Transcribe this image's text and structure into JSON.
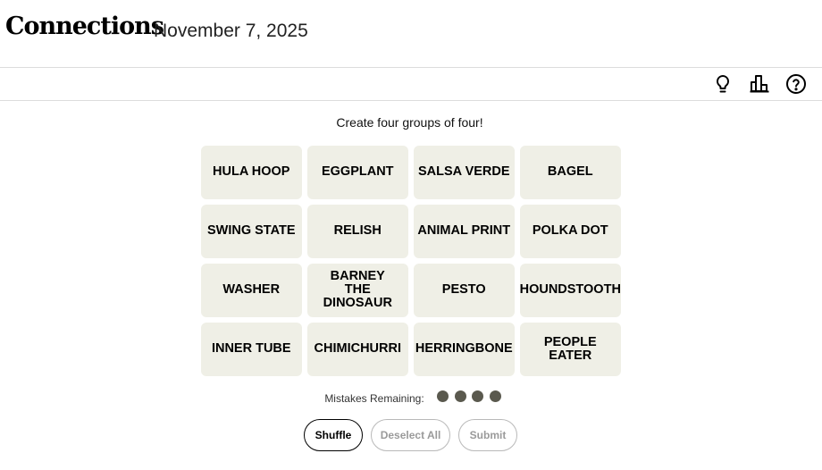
{
  "header": {
    "title": "Connections",
    "date": "November 7, 2025"
  },
  "toolbar": {
    "icons": [
      "lightbulb-icon",
      "leaderboard-icon",
      "help-icon"
    ]
  },
  "game": {
    "instructions": "Create four groups of four!",
    "tiles": [
      "HULA HOOP",
      "EGGPLANT",
      "SALSA VERDE",
      "BAGEL",
      "SWING STATE",
      "RELISH",
      "ANIMAL PRINT",
      "POLKA DOT",
      "WASHER",
      "BARNEY THE DINOSAUR",
      "PESTO",
      "HOUNDSTOOTH",
      "INNER TUBE",
      "CHIMICHURRI",
      "HERRINGBONE",
      "PEOPLE EATER"
    ],
    "mistakes_label": "Mistakes Remaining:",
    "mistakes_remaining": 4,
    "colors": {
      "tile_bg": "#efefe6",
      "dot": "#5a594e"
    }
  },
  "controls": {
    "shuffle_label": "Shuffle",
    "deselect_label": "Deselect All",
    "submit_label": "Submit"
  }
}
